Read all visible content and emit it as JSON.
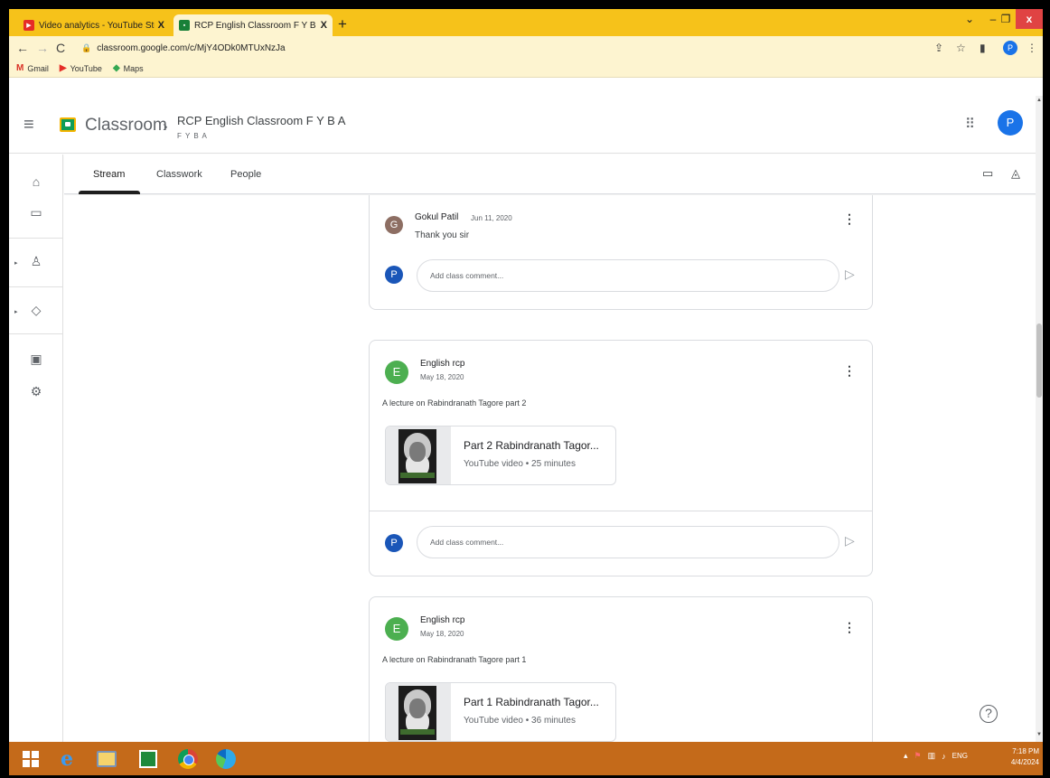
{
  "browser": {
    "tabs": [
      {
        "title": "Video analytics - YouTube Studio",
        "close": "X",
        "favicon": "youtube-icon"
      },
      {
        "title": "RCP English Classroom F Y B A F",
        "close": "X",
        "favicon": "classroom-icon"
      }
    ],
    "new_tab": "+",
    "url": "classroom.google.com/c/MjY4ODk0MTUxNzJa",
    "profile_initial": "P",
    "bookmarks": [
      {
        "label": "Gmail",
        "icon": "gmail-icon"
      },
      {
        "label": "YouTube",
        "icon": "youtube-icon"
      },
      {
        "label": "Maps",
        "icon": "maps-icon"
      }
    ],
    "window_controls": {
      "chevron": "⌄",
      "minimize": "–",
      "maximize": "❐",
      "close": "x"
    }
  },
  "header": {
    "app_name": "Classroom",
    "class_name": "RCP English Classroom F Y B A",
    "class_section": "F Y B A",
    "avatar_initial": "P"
  },
  "tabs": [
    "Stream",
    "Classwork",
    "People"
  ],
  "stream": {
    "comment_placeholder": "Add class comment...",
    "reply": {
      "author": "Gokul Patil",
      "date": "Jun 11, 2020",
      "text": "Thank you sir",
      "initial": "G"
    },
    "posts": [
      {
        "author": "English rcp",
        "initial": "E",
        "date": "May 18, 2020",
        "text": "A lecture on Rabindranath Tagore part 2",
        "attachment_title": "Part 2 Rabindranath Tagor...",
        "attachment_sub": "YouTube video • 25 minutes"
      },
      {
        "author": "English rcp",
        "initial": "E",
        "date": "May 18, 2020",
        "text": "A lecture on Rabindranath Tagore part 1",
        "attachment_title": "Part 1 Rabindranath Tagor...",
        "attachment_sub": "YouTube video • 36 minutes"
      }
    ],
    "commenter_initial": "P"
  },
  "help": "?",
  "taskbar": {
    "lang": "ENG",
    "time": "7:18 PM",
    "date": "4/4/2024"
  },
  "colors": {
    "browser_frame": "#f6c21a",
    "taskbar": "#c46a1a",
    "avatar": "#1a73e8",
    "post_avatar": "#4caf50"
  }
}
